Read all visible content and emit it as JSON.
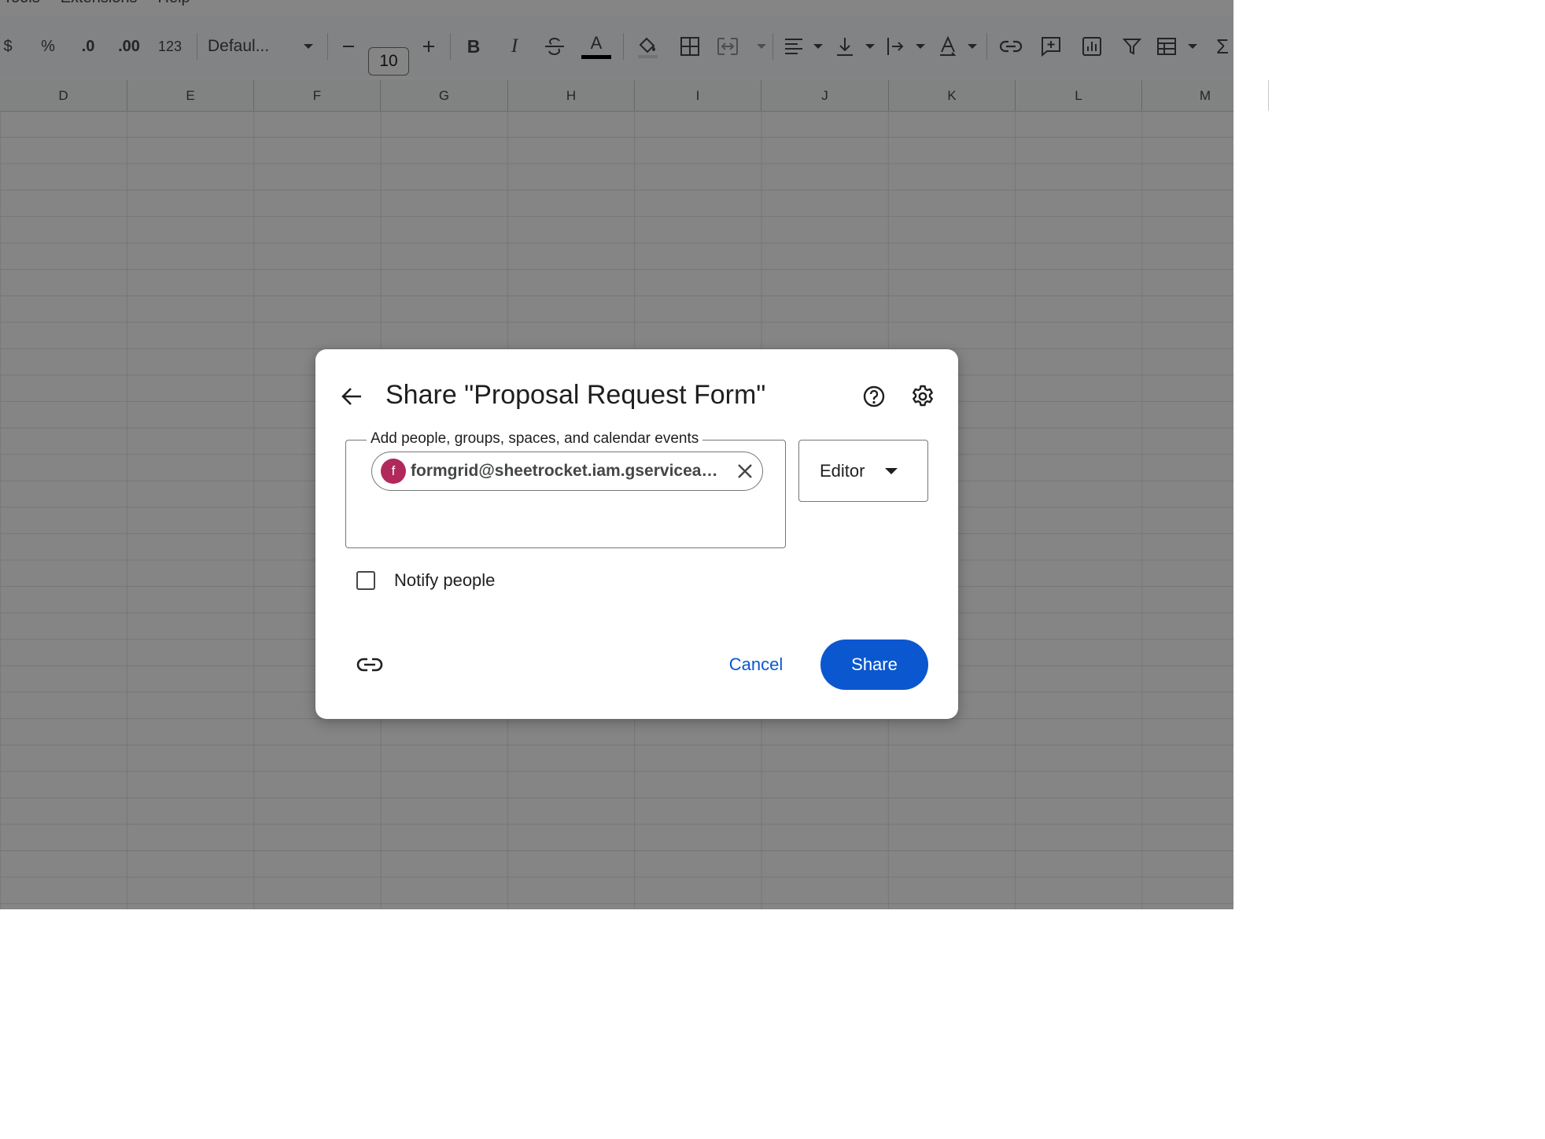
{
  "menubar": {
    "items": [
      "Tools",
      "Extensions",
      "Help"
    ]
  },
  "toolbar": {
    "currency": "$",
    "percent": "%",
    "decrease_decimal": ".0",
    "increase_decimal": ".00",
    "more_formats": "123",
    "font_name": "Defaul...",
    "font_size": "10",
    "bold": "B",
    "italic": "I",
    "text_color_glyph": "A",
    "sum": "Σ"
  },
  "columns": [
    "D",
    "E",
    "F",
    "G",
    "H",
    "I",
    "J",
    "K",
    "L",
    "M"
  ],
  "dialog": {
    "title": "Share \"Proposal Request Form\"",
    "add_field_label": "Add people, groups, spaces, and calendar events",
    "chip": {
      "avatar_letter": "f",
      "avatar_color": "#b0295a",
      "email": "formgrid@sheetrocket.iam.gserviceaccount.com"
    },
    "role": "Editor",
    "notify_label": "Notify people",
    "notify_checked": false,
    "cancel_label": "Cancel",
    "share_label": "Share",
    "accent_color": "#0b57d0"
  }
}
